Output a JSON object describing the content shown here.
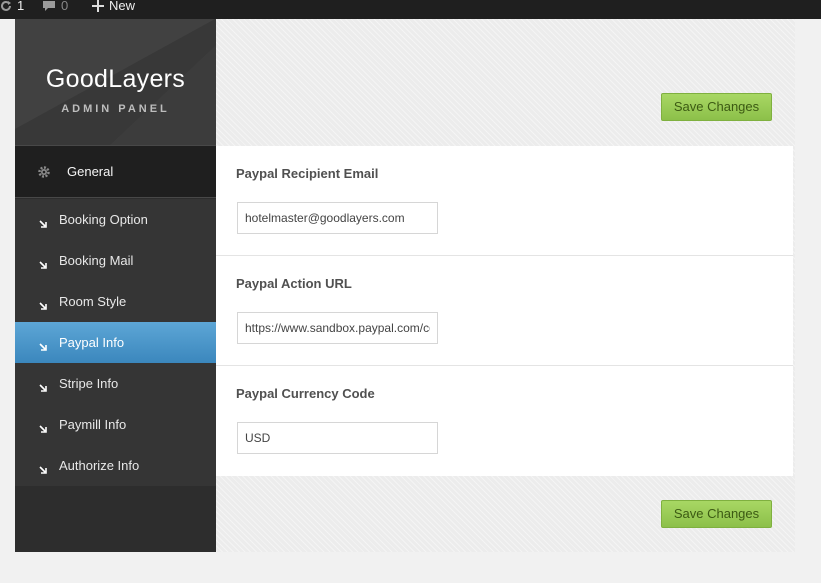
{
  "adminbar": {
    "updates_count": "1",
    "comments_count": "0",
    "new_label": "New",
    "icons": [
      "updates-icon",
      "comment-icon",
      "plus-icon"
    ]
  },
  "sidebar": {
    "brand_title": "GoodLayers",
    "brand_subtitle": "ADMIN PANEL",
    "section": {
      "label": "General",
      "icon": "gear-icon"
    },
    "items": [
      {
        "label": "Booking Option",
        "active": false
      },
      {
        "label": "Booking Mail",
        "active": false
      },
      {
        "label": "Room Style",
        "active": false
      },
      {
        "label": "Paypal Info",
        "active": true
      },
      {
        "label": "Stripe Info",
        "active": false
      },
      {
        "label": "Paymill Info",
        "active": false
      },
      {
        "label": "Authorize Info",
        "active": false
      }
    ]
  },
  "main": {
    "save_label": "Save Changes",
    "fields": [
      {
        "label": "Paypal Recipient Email",
        "value": "hotelmaster@goodlayers.com"
      },
      {
        "label": "Paypal Action URL",
        "value": "https://www.sandbox.paypal.com/cgi-bin/webscr"
      },
      {
        "label": "Paypal Currency Code",
        "value": "USD"
      }
    ]
  },
  "colors": {
    "adminbar_bg": "#1f1f1f",
    "sidebar_bg": "#2d2d2d",
    "active_item": "#4a98cc",
    "save_button": "#99cc55"
  }
}
